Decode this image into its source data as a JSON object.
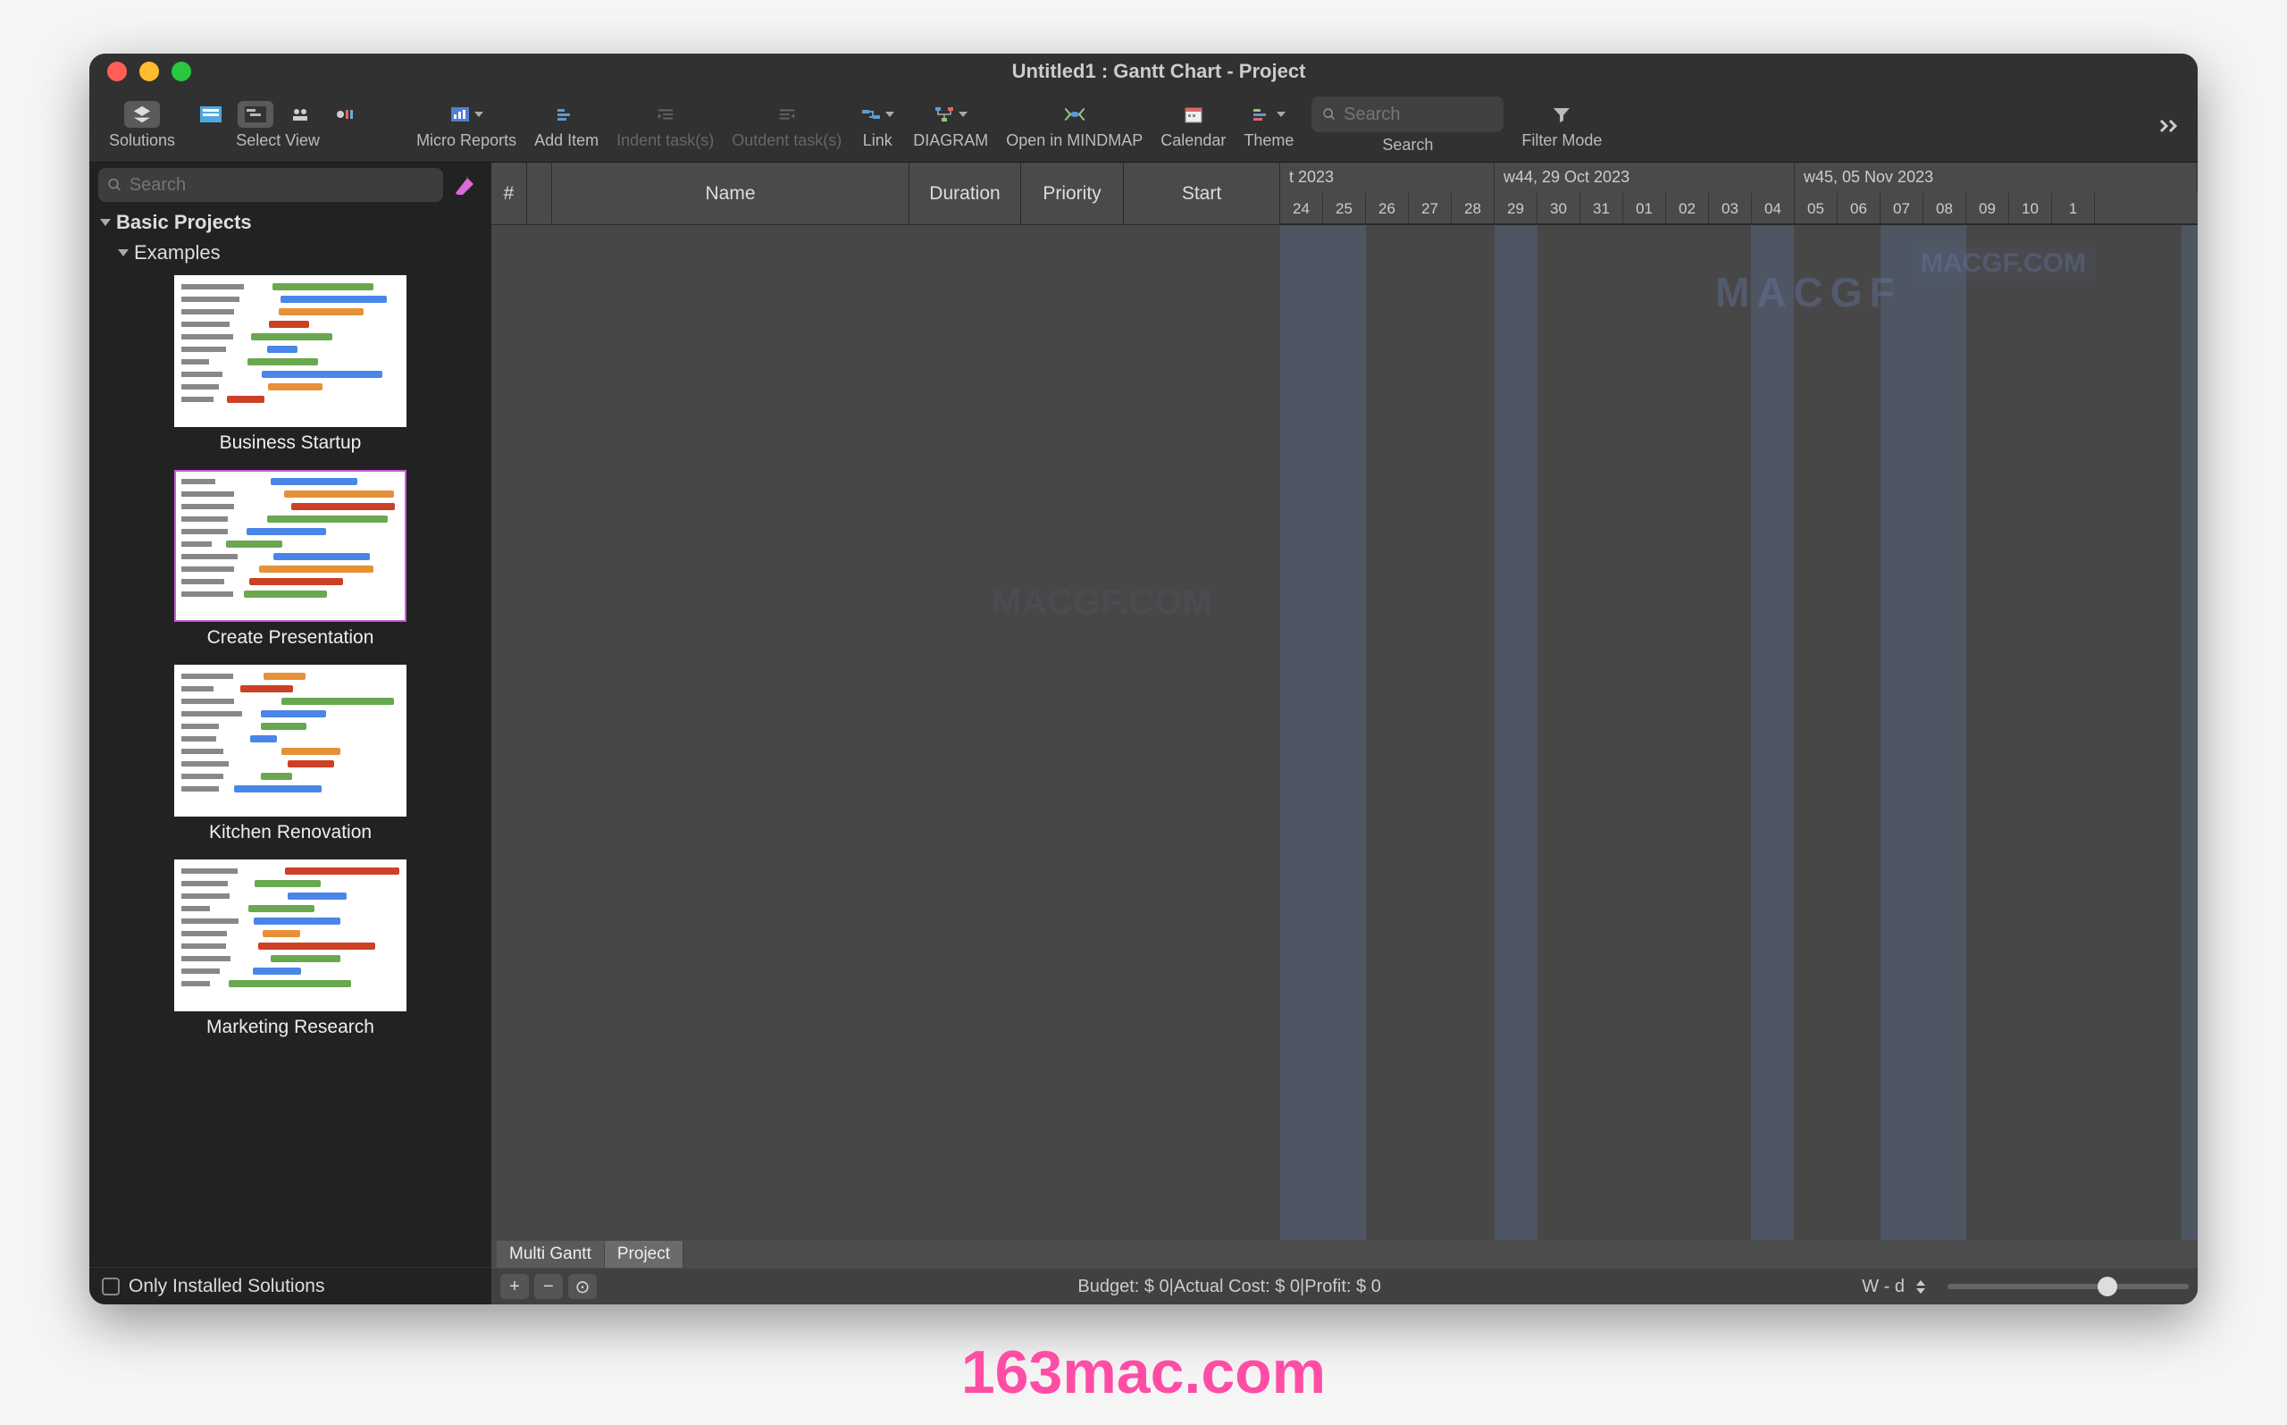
{
  "window": {
    "title": "Untitled1 : Gantt Chart - Project"
  },
  "toolbar": {
    "solutions": "Solutions",
    "selectView": "Select View",
    "microReports": "Micro Reports",
    "addItem": "Add Item",
    "indent": "Indent task(s)",
    "outdent": "Outdent task(s)",
    "link": "Link",
    "diagram": "DIAGRAM",
    "mindmap": "Open in MINDMAP",
    "calendar": "Calendar",
    "theme": "Theme",
    "search": "Search",
    "searchPlaceholder": "Search",
    "filterMode": "Filter Mode"
  },
  "sidebar": {
    "searchPlaceholder": "Search",
    "basicProjects": "Basic Projects",
    "examples": "Examples",
    "templates": [
      {
        "label": "Business Startup",
        "selected": false
      },
      {
        "label": "Create Presentation",
        "selected": true
      },
      {
        "label": "Kitchen Renovation",
        "selected": false
      },
      {
        "label": "Marketing Research",
        "selected": false
      }
    ],
    "onlyInstalled": "Only Installed Solutions"
  },
  "grid": {
    "columns": [
      "#",
      "",
      "Name",
      "Duration",
      "Priority",
      "Start"
    ],
    "weeks": [
      "t 2023",
      "w44, 29 Oct 2023",
      "w45, 05 Nov 2023"
    ],
    "days": [
      "24",
      "25",
      "26",
      "27",
      "28",
      "29",
      "30",
      "31",
      "01",
      "02",
      "03",
      "04",
      "05",
      "06",
      "07",
      "08",
      "09",
      "10",
      "1"
    ]
  },
  "tabs": {
    "multiGantt": "Multi Gantt",
    "project": "Project"
  },
  "statusbar": {
    "budget": "Budget: $ 0|Actual Cost: $ 0|Profit: $ 0",
    "scale": "W - d"
  },
  "watermarks": {
    "site": "163mac.com",
    "brand": "MACGF.COM"
  }
}
